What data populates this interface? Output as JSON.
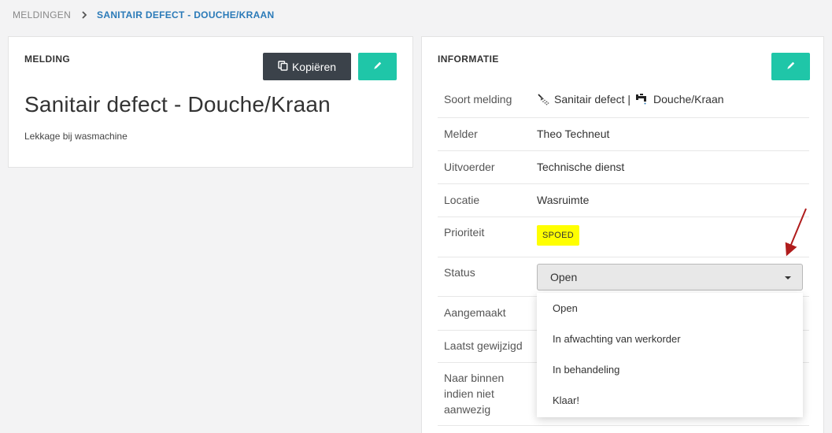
{
  "breadcrumb": {
    "root": "MELDINGEN",
    "current": "SANITAIR DEFECT - DOUCHE/KRAAN"
  },
  "melding": {
    "header": "MELDING",
    "copy_label": "Kopiëren",
    "title": "Sanitair defect - Douche/Kraan",
    "description": "Lekkage bij wasmachine"
  },
  "info": {
    "header": "INFORMATIE",
    "rows": [
      {
        "label": "Soort melding",
        "value_a": "Sanitair defect |",
        "value_b": "Douche/Kraan"
      },
      {
        "label": "Melder",
        "value": "Theo Techneut"
      },
      {
        "label": "Uitvoerder",
        "value": "Technische dienst"
      },
      {
        "label": "Locatie",
        "value": "Wasruimte"
      },
      {
        "label": "Prioriteit",
        "value": "SPOED"
      },
      {
        "label": "Status",
        "value": "Open"
      },
      {
        "label": "Aangemaakt"
      },
      {
        "label": "Laatst gewijzigd"
      },
      {
        "label": "Naar binnen\nindien niet\naanwezig"
      }
    ]
  },
  "status_options": [
    "Open",
    "In afwachting van werkorder",
    "In behandeling",
    "Klaar!"
  ],
  "colors": {
    "accent_teal": "#1fc6a8",
    "dark_button": "#3b424a",
    "link_blue": "#2f75b6",
    "priority_badge": "#ffff00",
    "annotation_arrow": "#b01c1c"
  },
  "icons": [
    "chevron-right-icon",
    "copy-icon",
    "pencil-icon",
    "shower-icon",
    "faucet-icon",
    "caret-down-icon"
  ]
}
